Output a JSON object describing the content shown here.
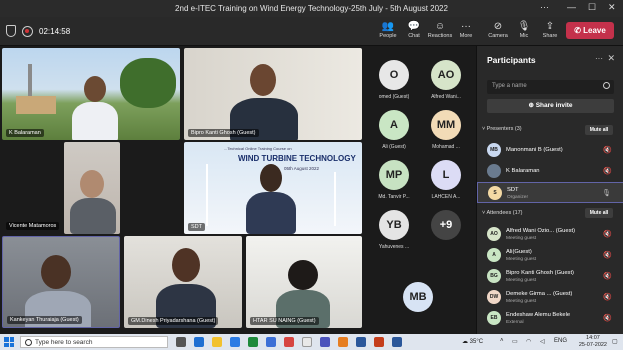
{
  "window": {
    "title": "2nd e-ITEC Training on Wind Energy Technology-25th July - 5th August 2022"
  },
  "toolbar": {
    "timer": "02:14:58",
    "buttons": [
      {
        "label": "People",
        "icon": "people-icon"
      },
      {
        "label": "Chat",
        "icon": "chat-icon"
      },
      {
        "label": "Reactions",
        "icon": "reactions-icon"
      },
      {
        "label": "More",
        "icon": "more-icon"
      },
      {
        "label": "Camera",
        "icon": "camera-off-icon"
      },
      {
        "label": "Mic",
        "icon": "mic-off-icon"
      },
      {
        "label": "Share",
        "icon": "share-icon"
      }
    ],
    "leave": "Leave"
  },
  "tiles": [
    {
      "name": "K Balaraman"
    },
    {
      "name": "Bipro Kanti Ghosh (Guest)"
    },
    {
      "name": "Vicente Matamoros"
    },
    {
      "name": "SDT"
    },
    {
      "name": "Kankeyan Thuraiaja (Guest)"
    },
    {
      "name": "GM.Dinesh Priyadarshana (Guest)"
    },
    {
      "name": "HTAR SU NAING (Guest)"
    }
  ],
  "slide": {
    "heading": "WIND TURBINE TECHNOLOGY",
    "sub": "...Technical Online Training Course on",
    "date": "05th August 2022"
  },
  "gallery": [
    {
      "initials": "O",
      "name": "omed (Guest)",
      "color": "#e7e7e7"
    },
    {
      "initials": "AO",
      "name": "Alfred Wani...",
      "color": "#d6e4c9"
    },
    {
      "initials": "A",
      "name": "Ali (Guest)",
      "color": "#c9e6c4"
    },
    {
      "initials": "MM",
      "name": "Mohamad ...",
      "color": "#f2dbb7"
    },
    {
      "initials": "MP",
      "name": "Md. Tanvir P...",
      "color": "#c7e2c2"
    },
    {
      "initials": "L",
      "name": "LAHCEN A...",
      "color": "#dcdcf5"
    },
    {
      "initials": "YB",
      "name": "Yahuvenes ...",
      "color": "#e4e4e4"
    },
    {
      "initials": "+9",
      "name": "",
      "color": "#444444"
    },
    {
      "initials": "MB",
      "name": "",
      "color": "#d7e3f4"
    }
  ],
  "participants": {
    "title": "Participants",
    "search_placeholder": "Type a name",
    "share_invite": "Share invite",
    "presenters_label": "Presenters (3)",
    "attendees_label": "Attendees (17)",
    "mute_all": "Mute all",
    "presenters": [
      {
        "initials": "MB",
        "name": "Manonmani B (Guest)",
        "sub": "",
        "color": "#c9d8f0"
      },
      {
        "initials": "",
        "name": "K Balaraman",
        "sub": "",
        "color": "#6a7b8f"
      },
      {
        "initials": "S",
        "name": "SDT",
        "sub": "Organizer",
        "color": "#f3d9a4"
      }
    ],
    "attendees": [
      {
        "initials": "AO",
        "name": "Alfred Wani Ozio...  (Guest)",
        "sub": "Meeting guest",
        "color": "#d6e4c9"
      },
      {
        "initials": "A",
        "name": "Ali(Guest)",
        "sub": "Meeting guest",
        "color": "#c9e6c4"
      },
      {
        "initials": "BG",
        "name": "Bipro Kanti Ghosh (Guest)",
        "sub": "Meeting guest",
        "color": "#c7e2c2"
      },
      {
        "initials": "DW",
        "name": "Demeke Girma ...  (Guest)",
        "sub": "Meeting guest",
        "color": "#f0d7c7"
      },
      {
        "initials": "EB",
        "name": "Endeshaw Alemu Bekele",
        "sub": "External",
        "color": "#c9e6c4"
      }
    ]
  },
  "taskbar": {
    "search_placeholder": "Type here to search",
    "temp": "35°C",
    "lang": "ENG",
    "time": "14:07",
    "date": "25-07-2022"
  }
}
